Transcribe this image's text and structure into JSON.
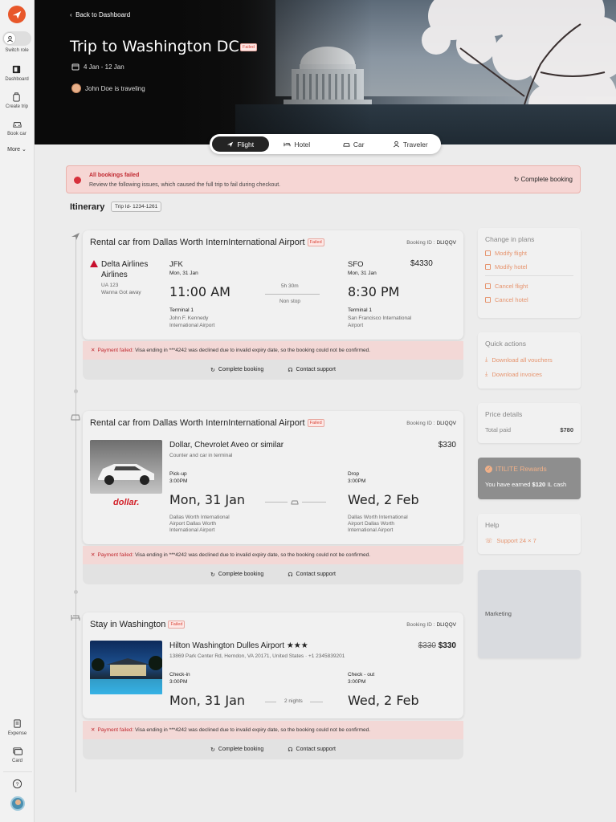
{
  "sidebar": {
    "switch_role": "Switch role",
    "items": [
      {
        "label": "Dashboard",
        "icon": "dashboard-icon"
      },
      {
        "label": "Create trip",
        "icon": "create-trip-icon"
      },
      {
        "label": "Book car",
        "icon": "car-icon"
      }
    ],
    "more": "More",
    "bottom": [
      {
        "label": "Expense",
        "icon": "expense-icon"
      },
      {
        "label": "Card",
        "icon": "card-icon"
      }
    ]
  },
  "hero": {
    "back": "Back to Dashboard",
    "title": "Trip to Washington DC",
    "status": "Failed",
    "dates": "4 Jan - 12 Jan",
    "traveler": "John Doe is traveling"
  },
  "tabs": [
    "Flight",
    "Hotel",
    "Car",
    "Traveler"
  ],
  "alert": {
    "title": "All bookings failed",
    "message": "Review the following issues, which caused the full trip to fail during checkout.",
    "action": "Complete booking"
  },
  "itinerary": {
    "title": "Itinerary",
    "trip_id": "Trip Id- 1234-1261"
  },
  "flight": {
    "title": "Rental car from Dallas Worth InternInternational Airport",
    "status": "Failed",
    "booking_id_label": "Booking ID :",
    "booking_id": "DLIQQV",
    "airline": "Delta Airlines Airlines",
    "flight_no": "UA 123",
    "fare": "Wanna Got away",
    "from_code": "JFK",
    "from_date": "Mon, 31 Jan",
    "from_time": "11:00 AM",
    "from_terminal": "Terminal 1",
    "from_airport": "John F. Kennedy International Airport",
    "duration": "5h 30m",
    "stops": "Non stop",
    "to_code": "SFO",
    "to_date": "Mon, 31 Jan",
    "to_time": "8:30 PM",
    "to_terminal": "Terminal 1",
    "to_airport": "San Francisco International Airport",
    "price": "$4330"
  },
  "car": {
    "title": "Rental car from Dallas Worth InternInternational Airport",
    "status": "Failed",
    "booking_id_label": "Booking ID :",
    "booking_id": "DLIQQV",
    "name": "Dollar, Chevrolet Aveo or similar",
    "subtitle": "Counter and car in terminal",
    "brand": "dollar.",
    "price": "$330",
    "pickup_label": "Pick-up",
    "pickup_time": "3:00PM",
    "pickup_date": "Mon, 31 Jan",
    "pickup_place": "Dallas Worth International Airport Dallas Worth International Airport",
    "drop_label": "Drop",
    "drop_time": "3:00PM",
    "drop_date": "Wed, 2 Feb",
    "drop_place": "Dallas Worth International Airport Dallas Worth International Airport"
  },
  "hotel": {
    "title": "Stay in Washington",
    "status": "Failed",
    "booking_id_label": "Booking ID :",
    "booking_id": "DLIQQV",
    "name": "Hilton Washington Dulles Airport",
    "stars": "★★★",
    "address": "13869 Park Center Rd, Herndon, VA 20171, United States · +1 2345839201",
    "old_price": "$330",
    "price": "$330",
    "checkin_label": "Check-in",
    "checkin_time": "3:00PM",
    "checkin_date": "Mon, 31 Jan",
    "nights": "2 nights",
    "checkout_label": "Check - out",
    "checkout_time": "3:00PM",
    "checkout_date": "Wed, 2 Feb"
  },
  "error": {
    "label": "Payment failed:",
    "message": "Visa ending in ***4242 was declined due to invalid expiry date, so the booking could not be confirmed."
  },
  "card_actions": {
    "complete": "Complete booking",
    "support": "Contact support"
  },
  "panels": {
    "change": {
      "title": "Change in plans",
      "links": [
        "Modify flight",
        "Modify hotel",
        "Cancel flight",
        "Cancel hotel"
      ]
    },
    "quick": {
      "title": "Quick actions",
      "links": [
        "Download all vouchers",
        "Download invoices"
      ]
    },
    "price": {
      "title": "Price details",
      "label": "Total paid",
      "value": "$780"
    },
    "rewards": {
      "title": "ITILITE Rewards",
      "prefix": "You have earned",
      "amount": "$120",
      "suffix": "IL cash"
    },
    "help": {
      "title": "Help",
      "link": "Support 24 × 7"
    },
    "marketing": "Marketing"
  },
  "colors": {
    "accent": "#e8572a",
    "error": "#c0282f",
    "link": "#e6946e"
  }
}
